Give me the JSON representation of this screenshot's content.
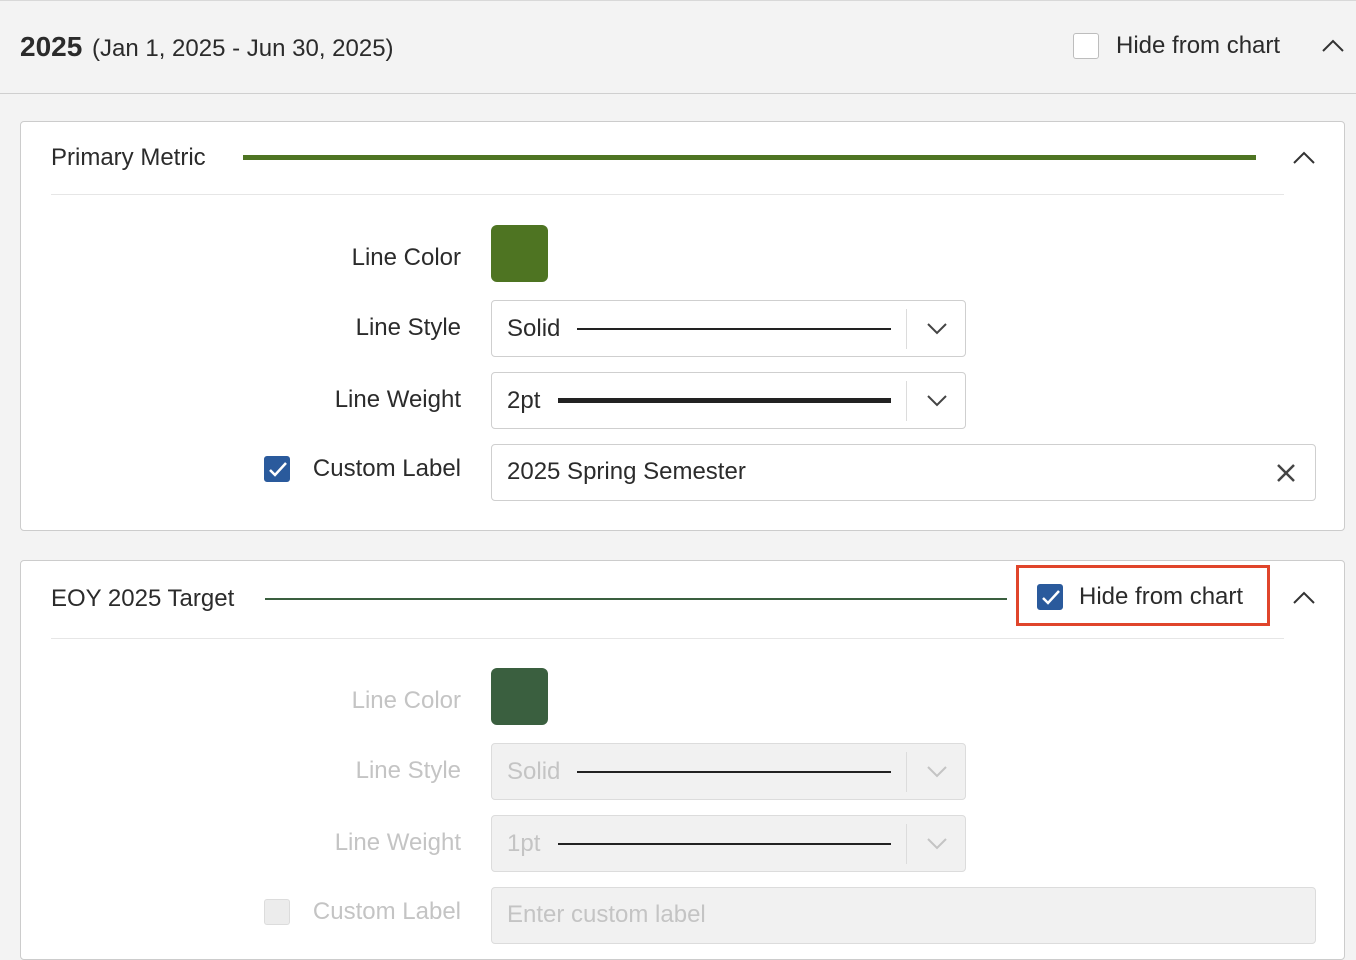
{
  "header": {
    "year": "2025",
    "range": "(Jan 1, 2025 - Jun 30, 2025)",
    "hide_label": "Hide from chart",
    "hide_checked": false
  },
  "primary": {
    "title": "Primary Metric",
    "line_color": "#4e7422",
    "labels": {
      "line_color": "Line Color",
      "line_style": "Line Style",
      "line_weight": "Line Weight",
      "custom_label": "Custom Label"
    },
    "line_style_value": "Solid",
    "line_weight_value": "2pt",
    "custom_label_checked": true,
    "custom_label_value": "2025 Spring Semester"
  },
  "target": {
    "title": "EOY 2025 Target",
    "line_color": "#3a5f3f",
    "hide_label": "Hide from chart",
    "hide_checked": true,
    "labels": {
      "line_color": "Line Color",
      "line_style": "Line Style",
      "line_weight": "Line Weight",
      "custom_label": "Custom Label"
    },
    "line_style_value": "Solid",
    "line_weight_value": "1pt",
    "custom_label_placeholder": "Enter custom label"
  },
  "icons": {
    "collapse": "chevron-up-icon",
    "dropdown": "chevron-down-icon",
    "clear": "close-icon",
    "check": "checkmark-icon"
  }
}
